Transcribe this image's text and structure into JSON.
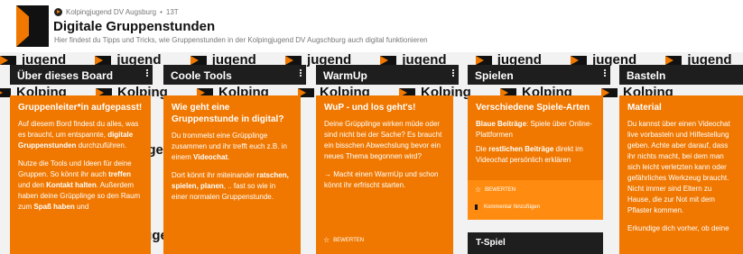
{
  "header": {
    "meta_author": "Kolpingjugend DV Augsburg",
    "meta_sep": "•",
    "meta_time": "13T",
    "title": "Digitale Gruppenstunden",
    "subtitle": "Hier findest du Tipps und Tricks, wie Gruppenstunden in der Kolpingjugend DV Augschburg auch digital funktionieren"
  },
  "background": {
    "word": "jugend",
    "word2": "Kolping"
  },
  "columns": [
    {
      "title": "Über dieses Board",
      "card": {
        "heading": "Gruppenleiter*in aufgepasst!",
        "p1a": "Auf diesem Bord findest du alles, was es braucht, um entspannte,",
        "p1b": "digitale Gruppenstunden",
        "p1c": "durchzuführen.",
        "p2a": "Nutze die Tools und Ideen für deine Gruppen. So könnt ihr auch",
        "p2b": "treffen",
        "p2c": "und den",
        "p2d": "Kontakt halten",
        "p2e": ". Außerdem haben deine Grüpplinge so den Raum zum",
        "p2f": "Spaß haben",
        "p2g": "und"
      }
    },
    {
      "title": "Coole Tools",
      "card": {
        "heading": "Wie geht eine Gruppenstunde in digital?",
        "p1a": "Du trommelst eine Grüpplinge zusammen und ihr trefft euch z.B. in einem",
        "p1b": "Videochat",
        "p1c": ".",
        "p2a": "Dort könnt ihr miteinander",
        "p2b": "ratschen, spielen, planen",
        "p2c": ", .. fast so wie in einer normalen Gruppenstunde."
      }
    },
    {
      "title": "WarmUp",
      "card": {
        "heading": "WuP - und los geht's!",
        "p1": "Deine Grüpplinge wirken müde oder sind nicht bei der Sache? Es braucht ein bisschen Abwechslung bevor ein neues Thema begonnen wird?",
        "p2": "→ Macht einen WarmUp und schon könnt ihr erfrischt starten.",
        "badge": "BEWERTEN"
      }
    },
    {
      "title": "Spielen",
      "card": {
        "heading": "Verschiedene Spiele-Arten",
        "p1a": "Blaue Beiträge",
        "p1b": ": Spiele über Online-Plattformen",
        "p2a": "Die",
        "p2b": "restlichen Beiträge",
        "p2c": "direkt im Videochat persönlich erklären",
        "badge": "BEWERTEN",
        "comment": "Kommentar hinzufügen"
      },
      "next_card": "T-Spiel"
    },
    {
      "title": "Basteln",
      "card": {
        "heading": "Material",
        "p1": "Du kannst über einen Videochat live vorbasteln und Hilfestellung geben. Achte aber darauf, dass ihr nichts macht, bei dem man sich leicht verletzten kann oder gefährliches Werkzeug braucht. Nicht immer sind Eltern zu Hause, die zur Not mit dem Pflaster kommen.",
        "p2": "Erkundige dich vorher, ob deine"
      }
    }
  ],
  "colors": {
    "accent": "#f07800",
    "dark": "#1e1e1e"
  }
}
